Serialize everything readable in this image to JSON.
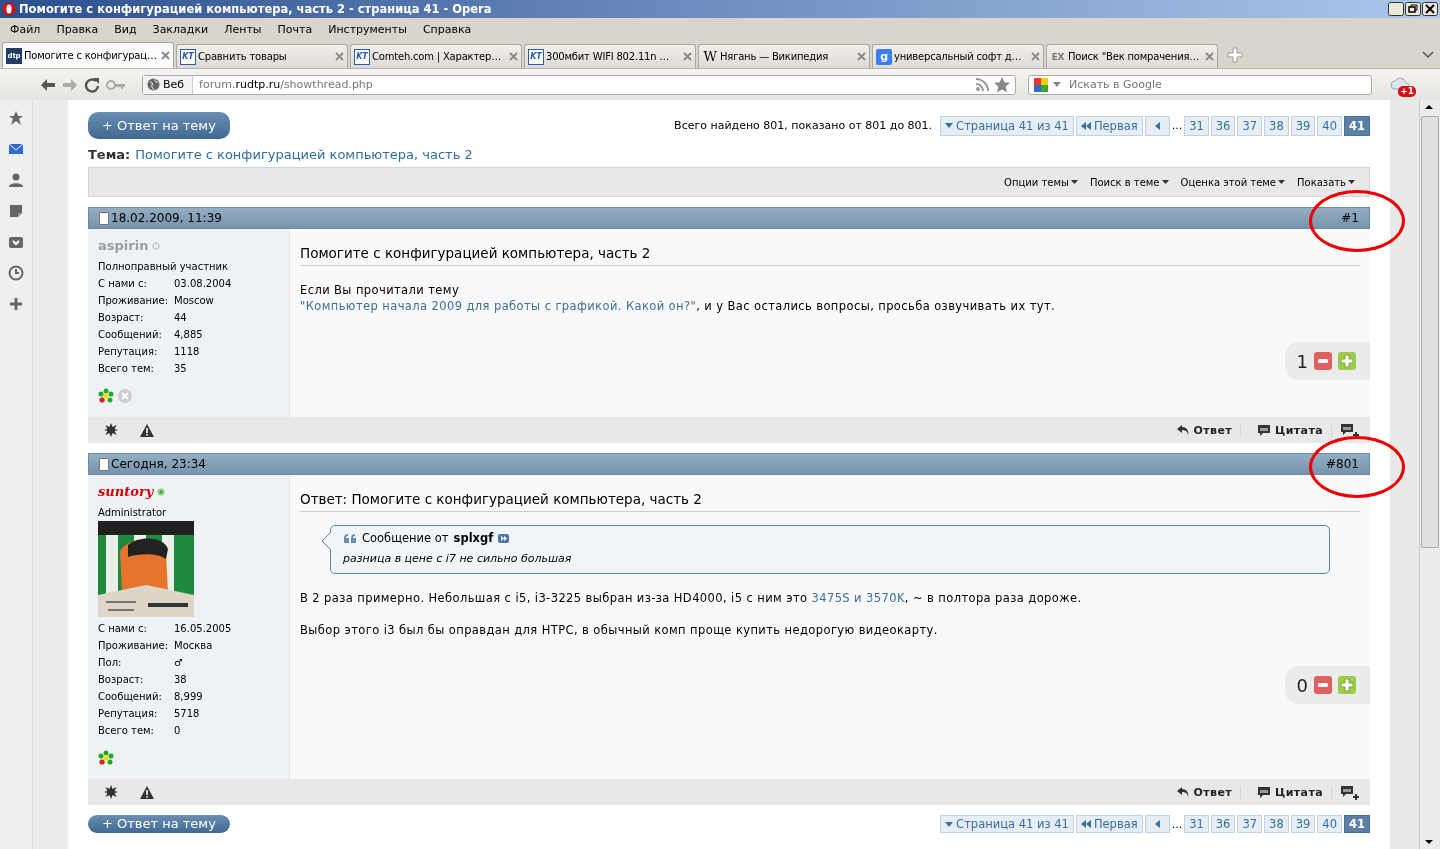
{
  "window": {
    "title": "Помогите с конфигурацией компьютера, часть 2 - страница 41 - Opera"
  },
  "menu": [
    "Файл",
    "Правка",
    "Вид",
    "Закладки",
    "Ленты",
    "Почта",
    "Инструменты",
    "Справка"
  ],
  "tabs": [
    {
      "label": "Помогите с конфигурац…",
      "favicon": "dtp",
      "kind": "dtp",
      "selected": true
    },
    {
      "label": "Сравнить товары",
      "favicon": "KT",
      "kind": "kt",
      "selected": false
    },
    {
      "label": "Comteh.com | Характер…",
      "favicon": "KT",
      "kind": "kt",
      "selected": false
    },
    {
      "label": "300мбит WIFI 802.11n …",
      "favicon": "KT",
      "kind": "kt",
      "selected": false
    },
    {
      "label": "Нягань — Википедия",
      "favicon": "W",
      "kind": "wiki",
      "selected": false
    },
    {
      "label": "универсальный софт д…",
      "favicon": "g",
      "kind": "google",
      "selected": false
    },
    {
      "label": "Поиск \"Век помрачения…",
      "favicon": "EX",
      "kind": "ex",
      "selected": false
    }
  ],
  "address": {
    "label": "Веб",
    "url": "forum.**rudtp.ru**/showthread.php"
  },
  "search": {
    "placeholder": "Искать в Google"
  },
  "notification_count": "+1",
  "forum": {
    "reply_button": "+ Ответ на тему",
    "results": "Всего найдено 801, показано от 801 до 801.",
    "pagination": {
      "summary": "Страница 41 из 41",
      "first": "Первая",
      "ellipsis": "...",
      "pages": [
        {
          "label": "31",
          "selected": false
        },
        {
          "label": "36",
          "selected": false
        },
        {
          "label": "37",
          "selected": false
        },
        {
          "label": "38",
          "selected": false
        },
        {
          "label": "39",
          "selected": false
        },
        {
          "label": "40",
          "selected": false
        },
        {
          "label": "41",
          "selected": true
        }
      ]
    },
    "thread": {
      "label": "Тема:",
      "title": "Помогите с конфигурацией компьютера, часть 2"
    },
    "tools": [
      "Опции темы",
      "Поиск в теме",
      "Оценка этой теме",
      "Показать"
    ],
    "posts": [
      {
        "date": "18.02.2009, 11:39",
        "number": "#1",
        "circled": true,
        "user": {
          "name": "aspirin",
          "kind": "member",
          "online": false,
          "rank": "Полноправный участник",
          "fields": [
            {
              "label": "С нами с:",
              "value": "03.08.2004"
            },
            {
              "label": "Проживание:",
              "value": "Moscow"
            },
            {
              "label": "Возраст:",
              "value": "44"
            },
            {
              "label": "Сообщений:",
              "value": "4,885"
            },
            {
              "label": "Репутация:",
              "value": "1118"
            },
            {
              "label": "Всего тем:",
              "value": "35"
            }
          ],
          "contacts": [
            {
              "kind": "icq"
            },
            {
              "kind": "skype"
            }
          ]
        },
        "title": "Помогите с конфигурацией компьютера, часть 2",
        "paragraphs": [
          [
            {
              "kind": "text",
              "text": "Если Вы прочитали тему"
            },
            {
              "kind": "break"
            },
            {
              "kind": "link",
              "text": "\"Компьютер начала 2009 для работы с графикой. Какой он?\""
            },
            {
              "kind": "text",
              "text": ", и у Вас остались вопросы, просьба озвучивать их тут."
            }
          ]
        ],
        "rating": "1",
        "actions": [
          "Ответ",
          "Цитата"
        ]
      },
      {
        "date": "Сегодня, 23:34",
        "number": "#801",
        "circled": true,
        "user": {
          "name": "suntory",
          "kind": "admin",
          "online": true,
          "rank": "Administrator",
          "fields": [
            {
              "label": "С нами с:",
              "value": "16.05.2005"
            },
            {
              "label": "Проживание:",
              "value": "Москва"
            },
            {
              "label": "Пол:",
              "value": "♂"
            },
            {
              "label": "Возраст:",
              "value": "38"
            },
            {
              "label": "Сообщений:",
              "value": "8,999"
            },
            {
              "label": "Репутация:",
              "value": "5718"
            },
            {
              "label": "Всего тем:",
              "value": "0"
            }
          ],
          "contacts": [
            {
              "kind": "icq"
            }
          ]
        },
        "title": "Ответ: Помогите с конфигурацией компьютера, часть 2",
        "quote": {
          "label": "Сообщение от",
          "author": "splxgf",
          "text": "разница в цене с i7 не сильно большая"
        },
        "paragraphs": [
          [
            {
              "kind": "text",
              "text": "В 2 раза примерно. Небольшая с i5, i3-3225 выбран из-за HD4000, i5 с ним это "
            },
            {
              "kind": "link",
              "text": "3475S и 3570K"
            },
            {
              "kind": "text",
              "text": ", ~ в полтора раза дороже."
            }
          ],
          [
            {
              "kind": "text",
              "text": "Выбор этого i3 был бы оправдан для HTPC, в обычный комп проще купить недорогую видеокарту."
            }
          ]
        ],
        "rating": "0",
        "actions": [
          "Ответ",
          "Цитата"
        ]
      }
    ],
    "bottom_bar": {
      "reply_button": "+ Ответ на тему",
      "pagination": {
        "summary": "Страница 41 из 41",
        "first": "Первая",
        "ellipsis": "...",
        "pages": [
          {
            "label": "31",
            "selected": false
          },
          {
            "label": "36",
            "selected": false
          },
          {
            "label": "37",
            "selected": false
          },
          {
            "label": "38",
            "selected": false
          },
          {
            "label": "39",
            "selected": false
          },
          {
            "label": "40",
            "selected": false
          },
          {
            "label": "41",
            "selected": true
          }
        ]
      }
    }
  }
}
